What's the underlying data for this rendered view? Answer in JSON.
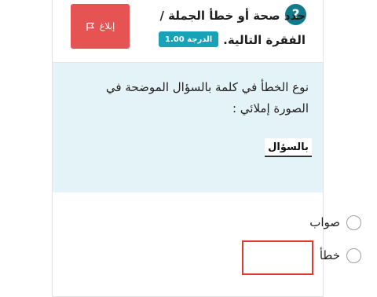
{
  "question": {
    "help_icon": "?",
    "title_line1": "حدد صحة أو خطأ الجملة /",
    "title_line2": "الفقرة التالية.",
    "grade_label": "الدرجة 1.00",
    "report_label": "إبلاغ",
    "report_icon": "flag-icon",
    "body_text": "نوع الخطأ في كلمة بالسؤال الموضحة في الصورة إملائي :",
    "image_word": "بالسؤال"
  },
  "options": [
    {
      "label": "صواب",
      "selected": false
    },
    {
      "label": "خطأ",
      "selected": false,
      "highlighted": true
    }
  ],
  "colors": {
    "accent": "#17a2b8",
    "report": "#e55353",
    "question_bg": "#e3f3f8",
    "highlight": "#e0392f"
  }
}
